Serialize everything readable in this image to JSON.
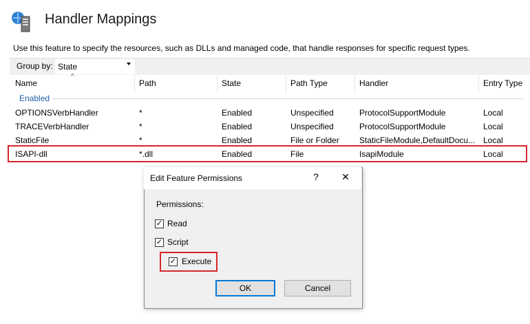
{
  "header": {
    "title": "Handler Mappings",
    "icon": "server-icon"
  },
  "description": "Use this feature to specify the resources, such as DLLs and managed code, that handle responses for specific request types.",
  "toolbar": {
    "group_by_label": "Group by:",
    "group_by_value": "State"
  },
  "table": {
    "columns": [
      "Name",
      "Path",
      "State",
      "Path Type",
      "Handler",
      "Entry Type"
    ],
    "group": "Enabled",
    "rows": [
      {
        "name": "OPTIONSVerbHandler",
        "path": "*",
        "state": "Enabled",
        "path_type": "Unspecified",
        "handler": "ProtocolSupportModule",
        "entry_type": "Local"
      },
      {
        "name": "TRACEVerbHandler",
        "path": "*",
        "state": "Enabled",
        "path_type": "Unspecified",
        "handler": "ProtocolSupportModule",
        "entry_type": "Local"
      },
      {
        "name": "StaticFile",
        "path": "*",
        "state": "Enabled",
        "path_type": "File or Folder",
        "handler": "StaticFileModule,DefaultDocu...",
        "entry_type": "Local"
      },
      {
        "name": "ISAPI-dll",
        "path": "*.dll",
        "state": "Enabled",
        "path_type": "File",
        "handler": "IsapiModule",
        "entry_type": "Local"
      }
    ]
  },
  "dialog": {
    "title": "Edit Feature Permissions",
    "help": "?",
    "close": "✕",
    "permissions_label": "Permissions:",
    "options": [
      {
        "label": "Read",
        "checked": true
      },
      {
        "label": "Script",
        "checked": true
      },
      {
        "label": "Execute",
        "checked": true
      }
    ],
    "ok_label": "OK",
    "cancel_label": "Cancel"
  },
  "colors": {
    "highlight": "#d7252c",
    "group": "#1f5fa8",
    "focus": "#0078d7"
  }
}
